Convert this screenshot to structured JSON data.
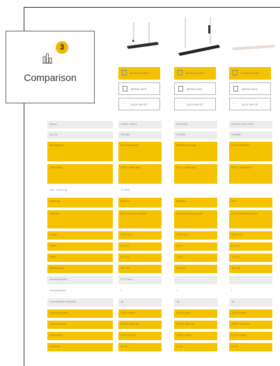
{
  "comparison": {
    "badge_count": "3",
    "label": "Comparison",
    "icon": "compare-icon"
  },
  "products": [
    {
      "cart_label": "IN DEN KORB",
      "list_label": "MERKLISTE",
      "info_label": "ALLE INFOS"
    },
    {
      "cart_label": "IN DEN KORB",
      "list_label": "MERKLISTE",
      "info_label": "ALLE INFOS"
    },
    {
      "cart_label": "IN DEN KORB",
      "list_label": "MERKLISTE",
      "info_label": "ALLE INFOS"
    }
  ],
  "table": {
    "rows": [
      {
        "label": "Name",
        "values": [
          "LONG GRILL",
          "GLASUS",
          "OVERLIGHT PRO"
        ]
      },
      {
        "label": "Art.-Nr.",
        "values": [
          "199360",
          "219999",
          "199865"
        ]
      },
      {
        "label": "Montageart",
        "values": [
          "Deckenaufbau",
          "Deckenmontage",
          "Pendel Aufbau"
        ]
      },
      {
        "label": "Steuerung",
        "values": [
          "DALI / Standard",
          "DALI / Standard",
          "DALI / Standard"
        ]
      },
      {
        "label": "Max. Leistung",
        "values": [
          "75 Watt",
          "–",
          "–"
        ]
      },
      {
        "label": "Leistung",
        "values": [
          "Einbaut",
          "Einbaut",
          "Alle"
        ]
      },
      {
        "label": "Material",
        "values": [
          "Aluminium/Kunststoff",
          "Aluminium/Kunststoff",
          "Aluminium/Kunststoff"
        ]
      },
      {
        "label": "Länge",
        "values": [
          "114,5 cm",
          "109,1 cm",
          "114,5 cm"
        ]
      },
      {
        "label": "Breite",
        "values": [
          "4,5 cm",
          "6 cm",
          "6,5 cm"
        ]
      },
      {
        "label": "Höhe",
        "values": [
          "8,5 cm",
          "7 cm",
          "7,5 cm"
        ]
      },
      {
        "label": "Abhängung",
        "values": [
          "150 cm",
          "200 cm",
          "150 cm"
        ]
      },
      {
        "label": "Abstrahlwinkel",
        "values": [
          "270 Grad",
          "–",
          "–"
        ]
      },
      {
        "label": "Schutzklasse",
        "values": [
          "I",
          "I",
          "I"
        ]
      },
      {
        "label": "Leuchtmittel inklusive",
        "values": [
          "Ja",
          "Ja",
          "Ja"
        ]
      },
      {
        "label": "Farbtemperatur",
        "values": [
          "3000 Kelvin",
          "3000 Kelvin",
          "3000 Kelvin"
        ]
      },
      {
        "label": "Lebens-dauer",
        "values": [
          "35000 Stunden",
          "35000 Stunden",
          "35000 Stunden"
        ]
      },
      {
        "label": "Lichtstrom",
        "values": [
          "2600 Lumen",
          "3000 Lumen",
          "2700 Lumen"
        ]
      },
      {
        "label": "Leistung",
        "values": [
          "24 W",
          "24 W",
          "24 W"
        ]
      }
    ]
  }
}
